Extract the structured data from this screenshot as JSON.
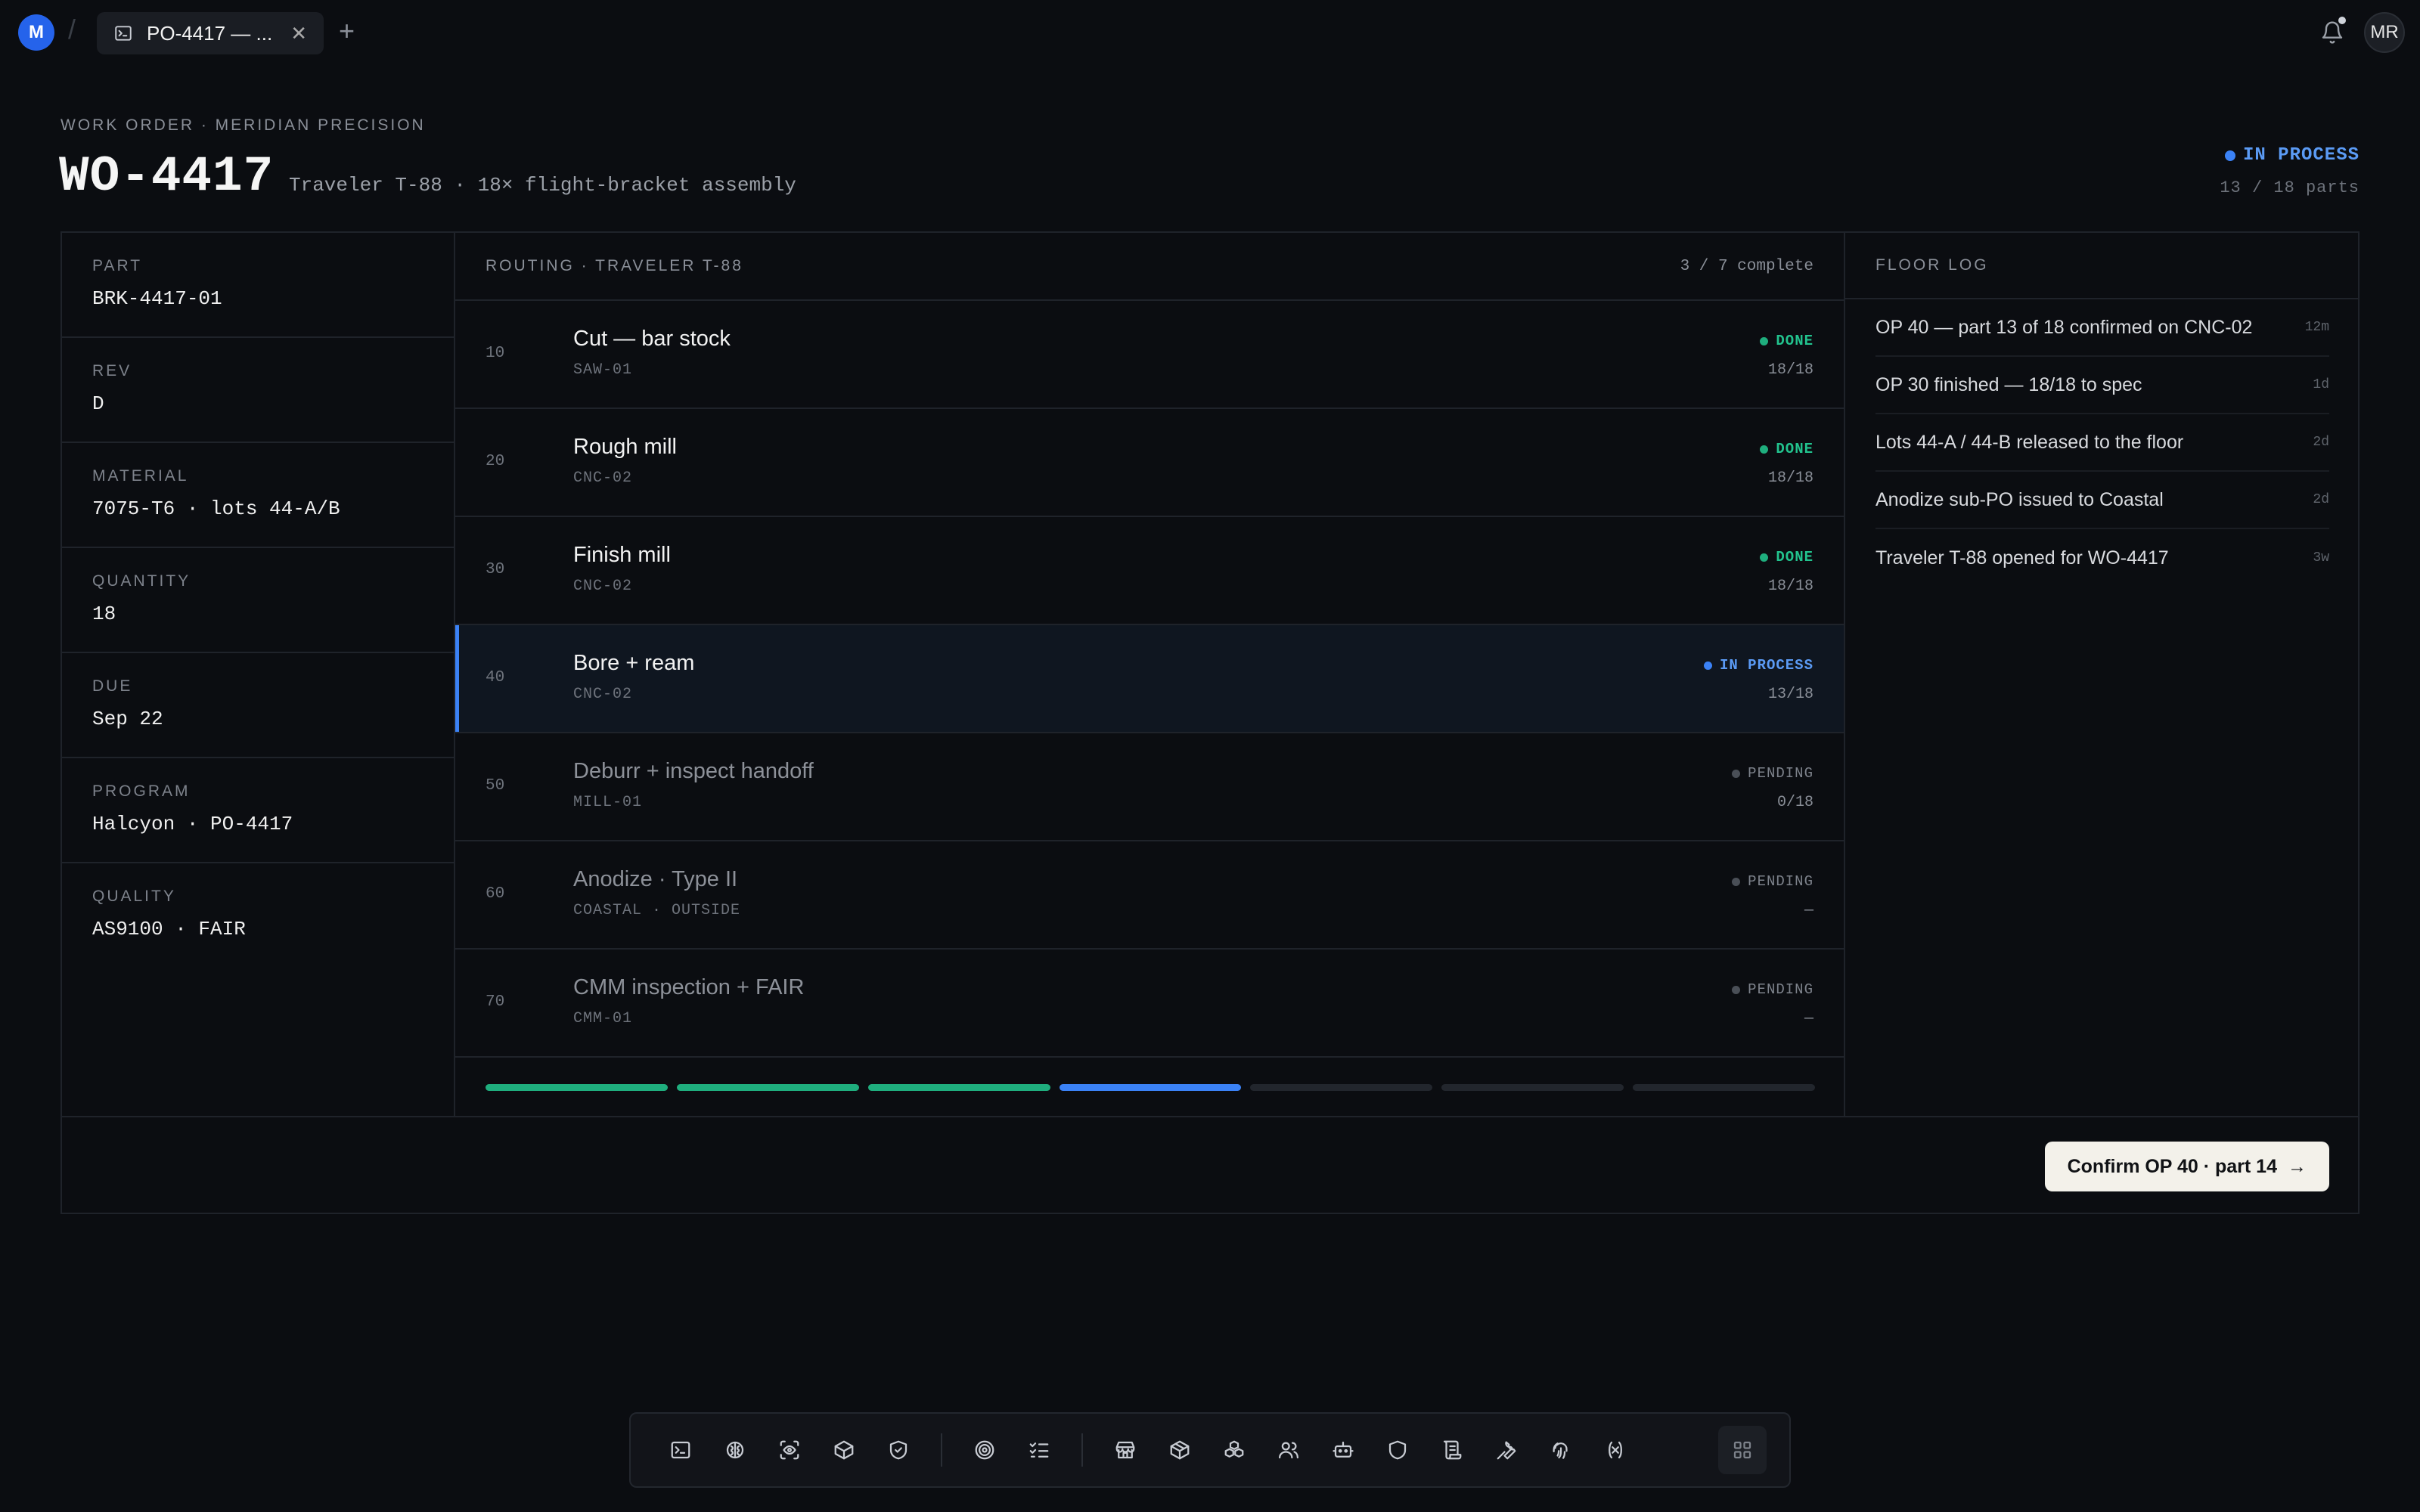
{
  "topbar": {
    "workspace_initial": "M",
    "tab_title": "PO-4417 — ...",
    "user_initials": "MR"
  },
  "header": {
    "eyebrow": "WORK ORDER · MERIDIAN PRECISION",
    "title": "WO-4417",
    "subtitle": "Traveler T-88 · 18× flight-bracket assembly",
    "status": "IN PROCESS",
    "status_color": "#3b82f6",
    "parts": "13 / 18 parts"
  },
  "fields": [
    {
      "label": "PART",
      "value": "BRK-4417-01"
    },
    {
      "label": "REV",
      "value": "D"
    },
    {
      "label": "MATERIAL",
      "value": "7075-T6 · lots 44-A/B"
    },
    {
      "label": "QUANTITY",
      "value": "18"
    },
    {
      "label": "DUE",
      "value": "Sep 22"
    },
    {
      "label": "PROGRAM",
      "value": "Halcyon · PO-4417"
    },
    {
      "label": "QUALITY",
      "value": "AS9100 · FAIR"
    }
  ],
  "routing": {
    "title": "ROUTING · TRAVELER T-88",
    "summary": "3 / 7 complete",
    "ops": [
      {
        "num": "10",
        "name": "Cut — bar stock",
        "machine": "SAW-01",
        "status": "DONE",
        "count": "18/18"
      },
      {
        "num": "20",
        "name": "Rough mill",
        "machine": "CNC-02",
        "status": "DONE",
        "count": "18/18"
      },
      {
        "num": "30",
        "name": "Finish mill",
        "machine": "CNC-02",
        "status": "DONE",
        "count": "18/18"
      },
      {
        "num": "40",
        "name": "Bore + ream",
        "machine": "CNC-02",
        "status": "IN PROCESS",
        "count": "13/18"
      },
      {
        "num": "50",
        "name": "Deburr + inspect handoff",
        "machine": "MILL-01",
        "status": "PENDING",
        "count": "0/18"
      },
      {
        "num": "60",
        "name": "Anodize · Type II",
        "machine": "COASTAL · OUTSIDE",
        "status": "PENDING",
        "count": "—"
      },
      {
        "num": "70",
        "name": "CMM inspection + FAIR",
        "machine": "CMM-01",
        "status": "PENDING",
        "count": "—"
      }
    ],
    "progress_segments": [
      "done",
      "done",
      "done",
      "in-process",
      "pending",
      "pending",
      "pending"
    ]
  },
  "floor_log": {
    "title": "FLOOR LOG",
    "items": [
      {
        "text": "OP 40 — part 13 of 18 confirmed on CNC-02",
        "time": "12m"
      },
      {
        "text": "OP 30 finished — 18/18 to spec",
        "time": "1d"
      },
      {
        "text": "Lots 44-A / 44-B released to the floor",
        "time": "2d"
      },
      {
        "text": "Anodize sub-PO issued to Coastal",
        "time": "2d"
      },
      {
        "text": "Traveler T-88 opened for WO-4417",
        "time": "3w"
      }
    ]
  },
  "actions": {
    "confirm_label": "Confirm OP 40 · part 14",
    "confirm_arrow": "→"
  },
  "colors": {
    "done": "#1fae7e",
    "in_process": "#3b82f6",
    "pending": "#22262d",
    "background": "#0b0d11"
  },
  "dock": {
    "icons": [
      "terminal-icon",
      "brain-icon",
      "scan-eye-icon",
      "box-icon",
      "shield-check-icon",
      "target-icon",
      "list-checks-icon",
      "store-icon",
      "package-icon",
      "boxes-icon",
      "users-icon",
      "bot-icon",
      "shield-icon",
      "scroll-icon",
      "wrench-icon",
      "fingerprint-icon",
      "variable-icon",
      "grid-icon"
    ]
  }
}
